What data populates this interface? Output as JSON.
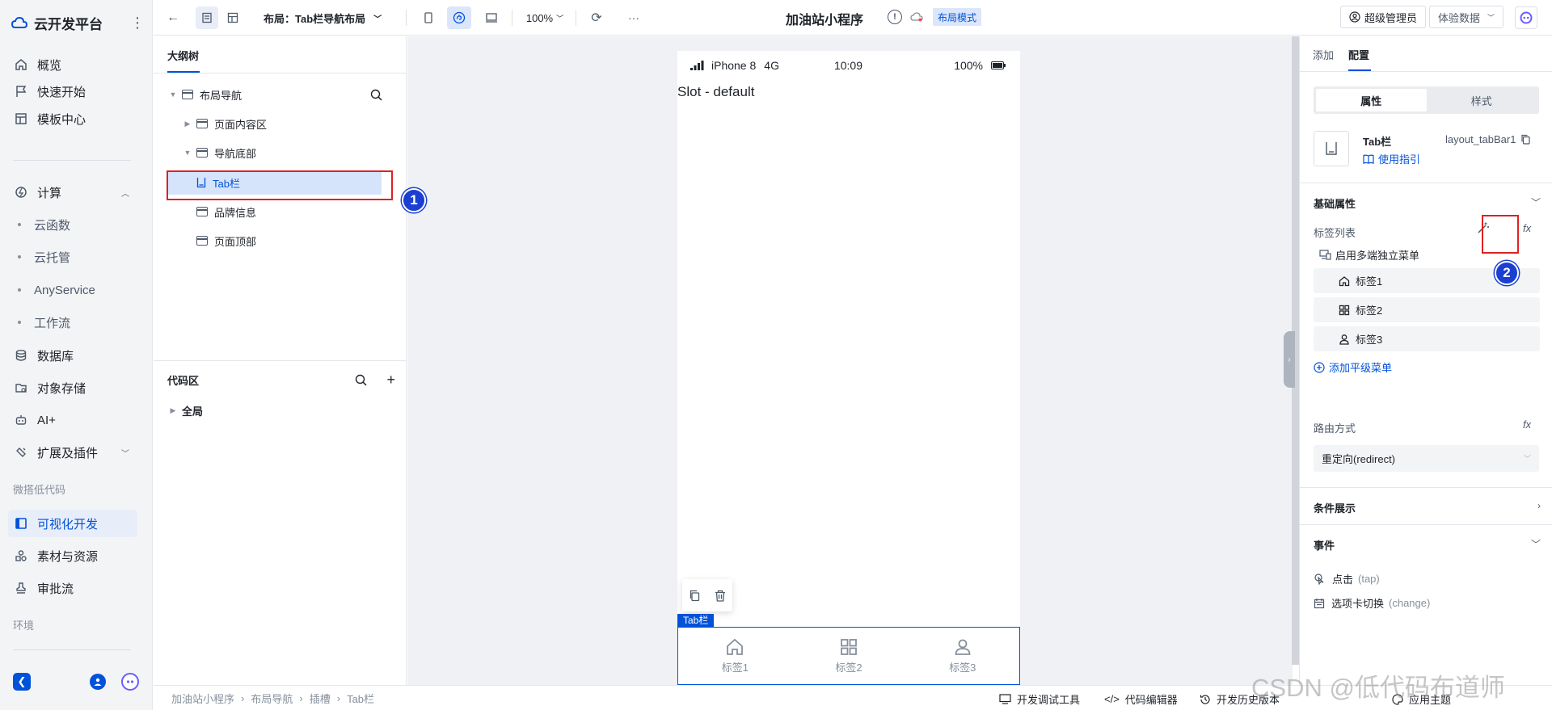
{
  "app": {
    "name": "云开发平台",
    "more_glyph": "⋮"
  },
  "sidebar": {
    "items": [
      {
        "label": "概览",
        "icon": "home-icon"
      },
      {
        "label": "快速开始",
        "icon": "flag-icon"
      },
      {
        "label": "模板中心",
        "icon": "template-icon"
      }
    ],
    "compute": {
      "label": "计算",
      "icon": "compute-icon",
      "expanded": true
    },
    "compute_children": [
      "云函数",
      "云托管",
      "AnyService",
      "工作流"
    ],
    "items2": [
      {
        "label": "数据库",
        "icon": "database-icon"
      },
      {
        "label": "对象存储",
        "icon": "storage-icon"
      },
      {
        "label": "AI+",
        "icon": "robot-icon"
      },
      {
        "label": "扩展及插件",
        "icon": "plugin-icon"
      }
    ],
    "group_lowcode": "微搭低代码",
    "lowcode_items": [
      {
        "label": "可视化开发",
        "icon": "layout-icon",
        "active": true
      },
      {
        "label": "素材与资源",
        "icon": "shapes-icon"
      },
      {
        "label": "审批流",
        "icon": "stamp-icon"
      }
    ],
    "group_env": "环境"
  },
  "toolbar": {
    "layout_label": "布局：Tab栏导航布局",
    "zoom": "100%",
    "more_glyph": "···",
    "app_title": "加油站小程序",
    "mode_badge": "布局模式",
    "user_label": "超级管理员",
    "data_select": "体验数据"
  },
  "outline": {
    "tab_label": "大纲树",
    "nodes": [
      {
        "label": "布局导航",
        "caret": "▼",
        "depth": 0
      },
      {
        "label": "页面内容区",
        "caret": "▶",
        "depth": 1
      },
      {
        "label": "导航底部",
        "caret": "▼",
        "depth": 1
      },
      {
        "label": "Tab栏",
        "caret": "",
        "depth": 2,
        "selected": true
      },
      {
        "label": "品牌信息",
        "caret": "",
        "depth": 1
      },
      {
        "label": "页面顶部",
        "caret": "",
        "depth": 1
      }
    ],
    "code_title": "代码区",
    "code_nodes": [
      {
        "label": "全局",
        "caret": "▶"
      }
    ]
  },
  "phone": {
    "carrier": "iPhone 8",
    "network": "4G",
    "time": "10:09",
    "battery": "100%",
    "slot_text": "Slot - default",
    "selection_label": "Tab栏",
    "tabs": [
      {
        "label": "标签1",
        "icon": "home-icon"
      },
      {
        "label": "标签2",
        "icon": "grid-icon"
      },
      {
        "label": "标签3",
        "icon": "user-icon"
      }
    ]
  },
  "right_panel": {
    "tabs": [
      "添加",
      "配置"
    ],
    "active_tab": "配置",
    "segments": [
      "属性",
      "样式"
    ],
    "active_segment": "属性",
    "component_name": "Tab栏",
    "component_id": "layout_tabBar1",
    "guide_link": "使用指引",
    "basic_title": "基础属性",
    "tag_list_label": "标签列表",
    "multi_menu_label": "启用多端独立菜单",
    "tag_items": [
      {
        "label": "标签1",
        "icon": "home-icon"
      },
      {
        "label": "标签2",
        "icon": "grid-icon"
      },
      {
        "label": "标签3",
        "icon": "user-icon"
      }
    ],
    "add_menu_label": "添加平级菜单",
    "route_label": "路由方式",
    "route_value": "重定向(redirect)",
    "condition_title": "条件展示",
    "events_title": "事件",
    "events": [
      {
        "label": "点击",
        "code": "(tap)",
        "icon": "tap-icon"
      },
      {
        "label": "选项卡切换",
        "code": "(change)",
        "icon": "calendar-icon"
      }
    ],
    "fx_glyph": "fx"
  },
  "breadcrumb": [
    "加油站小程序",
    "布局导航",
    "插槽",
    "Tab栏"
  ],
  "bottom_actions": [
    "开发调试工具",
    "代码编辑器",
    "开发历史版本",
    "应用主题"
  ],
  "annotations": [
    "1",
    "2"
  ],
  "watermark": "CSDN @低代码布道师",
  "colors": {
    "accent": "#0052d9",
    "annotation_red": "#e02020",
    "annotation_badge": "#1a3fd1"
  }
}
